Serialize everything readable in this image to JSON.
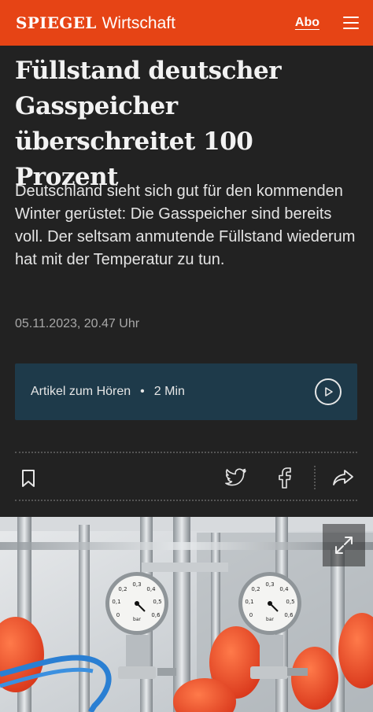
{
  "header": {
    "brand": "SPIEGEL",
    "section": "Wirtschaft",
    "abo_label": "Abo",
    "menu_icon": "hamburger-menu-icon",
    "color": "#e64415"
  },
  "article": {
    "headline": "Füllstand deutscher Gasspeicher überschreitet 100 Prozent",
    "lead": "Deutschland sieht sich gut für den kommenden Winter gerüstet: Die Gasspeicher sind bereits voll. Der seltsam anmutende Füllstand wiederum hat mit der Temperatur zu tun.",
    "date": "05.11.2023, 20.47 Uhr"
  },
  "audio": {
    "label": "Artikel zum Hören",
    "separator": "•",
    "duration": "2 Min",
    "icon": "play-circle-icon",
    "color": "#1e3a4a"
  },
  "actions": {
    "bookmark_icon": "bookmark-icon",
    "twitter_icon": "twitter-icon",
    "facebook_icon": "facebook-icon",
    "share_icon": "share-arrow-icon"
  },
  "image": {
    "expand_icon": "expand-icon",
    "gauge_ticks": [
      "0",
      "0,1",
      "0,2",
      "0,3",
      "0,4",
      "0,5",
      "0,6"
    ],
    "gauge_unit": "bar"
  }
}
